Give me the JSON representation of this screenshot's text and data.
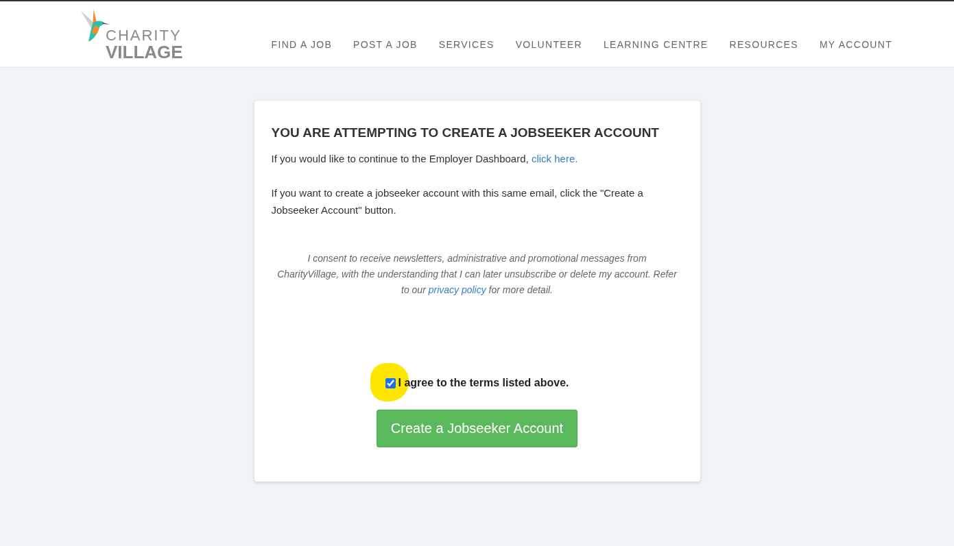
{
  "header": {
    "logo": {
      "line_1": "CHARITY",
      "line_2": "VILLAGE"
    },
    "nav": [
      {
        "label": "FIND A JOB"
      },
      {
        "label": "POST A JOB"
      },
      {
        "label": "SERVICES"
      },
      {
        "label": "VOLUNTEER"
      },
      {
        "label": "LEARNING CENTRE"
      },
      {
        "label": "RESOURCES"
      },
      {
        "label": "MY ACCOUNT"
      }
    ]
  },
  "card": {
    "title": "YOU ARE ATTEMPTING TO CREATE A JOBSEEKER ACCOUNT",
    "paragraphs": [
      {
        "text": "If you would like to continue to the Employer Dashboard,",
        "link": "click here."
      },
      {
        "text": "If you want to create a jobseeker account with this same email, click the \"Create a Jobseeker Account\" button."
      }
    ],
    "consent": {
      "text_before": "I consent to receive newsletters, administrative and promotional messages from CharityVillage, with the understanding that I can later unsubscribe or delete my account. Refer to our",
      "link": "privacy policy",
      "text_after": "for more detail."
    },
    "agree": {
      "label": "I agree to the terms listed above.",
      "checked": true,
      "highlighted": true
    },
    "button": "Create a Jobseeker Account"
  }
}
